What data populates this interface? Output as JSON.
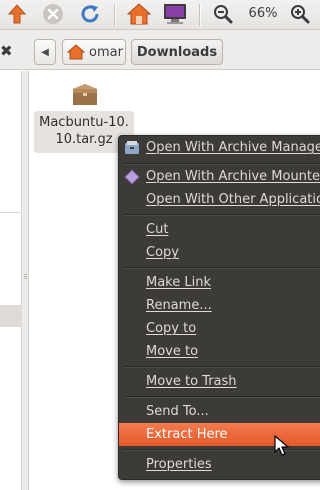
{
  "toolbar": {
    "icons": [
      "up-arrow-icon",
      "stop-icon",
      "reload-icon",
      "home-icon",
      "computer-icon",
      "zoom-out-icon",
      "zoom-in-icon"
    ],
    "zoom_level": "66%"
  },
  "location": {
    "close_glyph": "✖",
    "back_glyph": "◀",
    "home_label": "omar",
    "current_label": "Downloads"
  },
  "file": {
    "name": "Macbuntu-10.\n10.tar.gz",
    "icon": "archive-package-icon"
  },
  "context_menu": {
    "items": [
      {
        "label": "Open With Archive Manager",
        "icon": "archive-manager-icon"
      },
      {
        "label": "Open With Archive Mounter",
        "icon": "archive-mounter-icon"
      },
      {
        "label": "Open With Other Application"
      },
      {
        "label": "Cut"
      },
      {
        "label": "Copy"
      },
      {
        "label": "Make Link"
      },
      {
        "label": "Rename..."
      },
      {
        "label": "Copy to"
      },
      {
        "label": "Move to"
      },
      {
        "label": "Move to Trash"
      },
      {
        "label": "Send To..."
      },
      {
        "label": "Extract Here",
        "highlighted": true
      },
      {
        "label": "Properties"
      }
    ]
  },
  "colors": {
    "menu_background": "#3c3b37",
    "menu_highlight": "#e95b2b",
    "up_arrow": "#e8702c",
    "reload": "#3d7ac6"
  }
}
